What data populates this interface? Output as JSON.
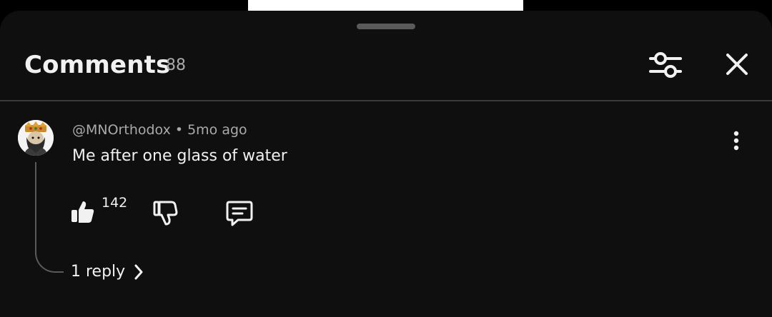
{
  "header": {
    "title": "Comments",
    "count": "88",
    "filter_icon": "sliders-icon",
    "close_icon": "close-icon"
  },
  "comment": {
    "author": "@MNOrthodox",
    "separator": "•",
    "time": "5mo ago",
    "text": "Me after one glass of water",
    "likes": "142",
    "actions": {
      "like_icon": "thumb-up-icon",
      "dislike_icon": "thumb-down-icon",
      "reply_icon": "comment-icon",
      "more_icon": "more-vertical-icon"
    },
    "replies": {
      "label": "1 reply",
      "icon": "chevron-right-icon"
    }
  },
  "colors": {
    "sheet_bg": "#0f0f0f",
    "primary_text": "#f1f1f1",
    "secondary_text": "#aaaaaa",
    "divider": "#3a3a3a"
  }
}
